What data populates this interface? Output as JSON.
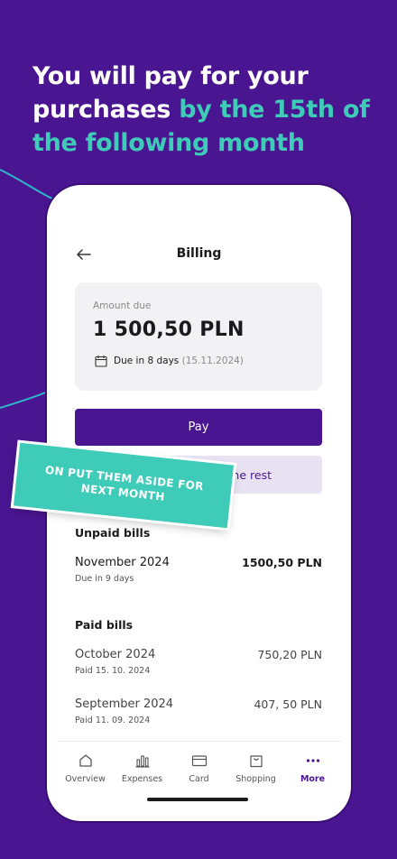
{
  "headline": {
    "part1": "You will pay for your purchases",
    "part2": "by the 15th of the following month"
  },
  "billing": {
    "title": "Billing",
    "amount_label": "Amount due",
    "amount_value": "1 500,50 PLN",
    "due_in": "Due in 8 days",
    "due_date": "(15.11.2024)",
    "pay_label": "Pay",
    "defer_label": "for the rest"
  },
  "sticker": {
    "line1": "ON PUT THEM ASIDE FOR",
    "line2": "NEXT MONTH"
  },
  "unpaid": {
    "header": "Unpaid bills",
    "items": [
      {
        "name": "November 2024",
        "sub": "Due in 9 days",
        "amount": "1500,50 PLN"
      }
    ]
  },
  "paid": {
    "header": "Paid bills",
    "items": [
      {
        "name": "October 2024",
        "sub": "Paid 15. 10. 2024",
        "amount": "750,20 PLN"
      },
      {
        "name": "September 2024",
        "sub": "Paid 11. 09. 2024",
        "amount": "407, 50 PLN"
      }
    ]
  },
  "tabs": [
    {
      "label": "Overview",
      "icon": "home-icon"
    },
    {
      "label": "Expenses",
      "icon": "bar-chart-icon"
    },
    {
      "label": "Card",
      "icon": "card-icon"
    },
    {
      "label": "Shopping",
      "icon": "shopping-bag-icon"
    },
    {
      "label": "More",
      "icon": "more-dots-icon",
      "active": true
    }
  ],
  "colors": {
    "background": "#4a1591",
    "accent": "#3ecbb7",
    "primary": "#4a1591"
  }
}
